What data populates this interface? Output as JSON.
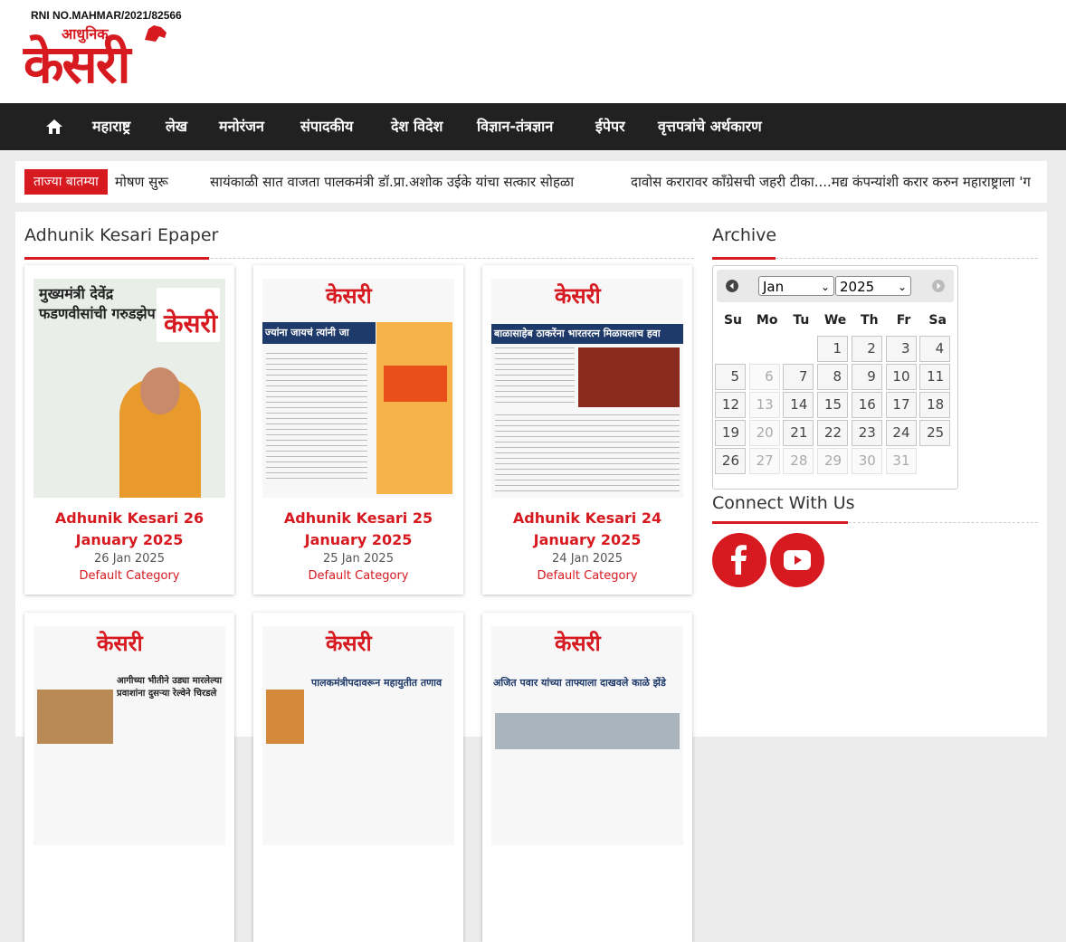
{
  "header": {
    "rni": "RNI NO.MAHMAR/2021/82566",
    "logo_small": "आधुनिक",
    "logo_big": "केसरी"
  },
  "nav": {
    "home_icon": "home-icon",
    "items": [
      "महाराष्ट्र",
      "लेख",
      "मनोरंजन",
      "संपादकीय",
      "देश विदेश",
      "विज्ञान-तंत्रज्ञान",
      "ईपेपर",
      "वृत्तपत्रांचे अर्थकारण"
    ]
  },
  "ticker": {
    "badge": "ताज्या बातम्या",
    "items": [
      "मोषण सुरू",
      "सायंकाळी सात वाजता पालकमंत्री डॉ.प्रा.अशोक उईके यांचा सत्कार सोहळा",
      "दावोस करारावर काँग्रेसची जहरी टीका....मद्य कंपन्यांशी करार करुन महाराष्ट्राला 'ग"
    ]
  },
  "main": {
    "title": "Adhunik Kesari Epaper",
    "cards": [
      {
        "title": "Adhunik Kesari 26 January 2025",
        "date": "26 Jan 2025",
        "category": "Default Category",
        "headline": "मुख्यमंत्री देवेंद्र फडणवीसांची गरुडझेप"
      },
      {
        "title": "Adhunik Kesari 25 January 2025",
        "date": "25 Jan 2025",
        "category": "Default Category",
        "headline": "ज्यांना जायचं त्यांनी जा"
      },
      {
        "title": "Adhunik Kesari 24 January 2025",
        "date": "24 Jan 2025",
        "category": "Default Category",
        "headline": "बाळासाहेब ठाकरेंना भारतरत्न मिळायलाच हवा"
      },
      {
        "title": "",
        "date": "",
        "category": "",
        "headline": "आगीच्या भीतीने उड्या मारलेल्या प्रवाशांना दुसऱ्या रेल्वेने चिरडले"
      },
      {
        "title": "",
        "date": "",
        "category": "",
        "headline": "पालकमंत्रीपदावरून महायुतीत तणाव"
      },
      {
        "title": "",
        "date": "",
        "category": "",
        "headline": "अजित पवार यांच्या ताफ्याला दाखवले काळे झेंडे"
      }
    ]
  },
  "sidebar": {
    "archive_title": "Archive",
    "calendar": {
      "month": "Jan",
      "year": "2025",
      "prev_icon": "prev-arrow-icon",
      "next_icon": "next-arrow-icon",
      "weekdays": [
        "Su",
        "Mo",
        "Tu",
        "We",
        "Th",
        "Fr",
        "Sa"
      ],
      "weeks": [
        [
          "",
          "",
          "",
          "1",
          "2",
          "3",
          "4"
        ],
        [
          "5",
          "6",
          "7",
          "8",
          "9",
          "10",
          "11"
        ],
        [
          "12",
          "13",
          "14",
          "15",
          "16",
          "17",
          "18"
        ],
        [
          "19",
          "20",
          "21",
          "22",
          "23",
          "24",
          "25"
        ],
        [
          "26",
          "27",
          "28",
          "29",
          "30",
          "31",
          ""
        ]
      ],
      "dim_days": [
        "6",
        "13",
        "20",
        "27",
        "28",
        "29",
        "30",
        "31"
      ]
    },
    "connect_title": "Connect With Us",
    "social": [
      "facebook-icon",
      "youtube-icon"
    ]
  },
  "colors": {
    "accent": "#d71920",
    "nav_bg": "#212121",
    "page_bg": "#ececec"
  }
}
